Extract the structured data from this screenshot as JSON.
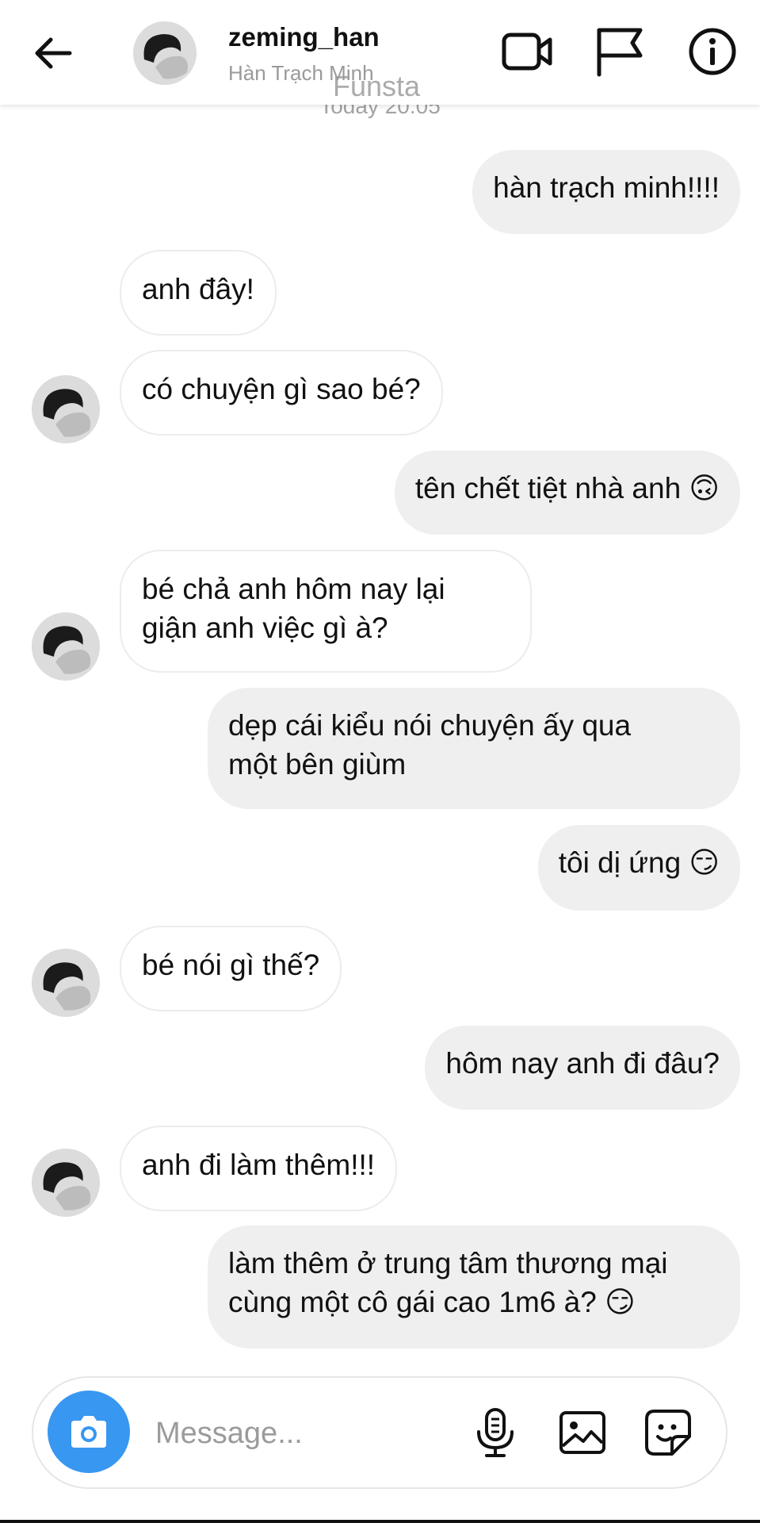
{
  "header": {
    "username": "zeming_han",
    "display_name": "Hàn Trạch Minh",
    "watermark": "Funsta"
  },
  "timestamp": "Today 20:05",
  "messages": [
    {
      "side": "sent",
      "text": "hàn trạch minh!!!!"
    },
    {
      "side": "recv",
      "text": "anh đây!"
    },
    {
      "side": "recv",
      "text": "có chuyện gì sao bé?"
    },
    {
      "side": "sent",
      "text": "tên chết tiệt nhà anh 🙃"
    },
    {
      "side": "recv",
      "text": "bé chả anh hôm nay lại\ngiận anh việc gì à?"
    },
    {
      "side": "sent",
      "text": "dẹp cái kiểu nói chuyện ấy qua\nmột bên giùm"
    },
    {
      "side": "sent",
      "text": "tôi dị ứng 😏"
    },
    {
      "side": "recv",
      "text": "bé nói gì thế?"
    },
    {
      "side": "sent",
      "text": "hôm nay anh đi đâu?"
    },
    {
      "side": "recv",
      "text": "anh đi làm thêm!!!"
    },
    {
      "side": "sent",
      "text": "làm thêm ở trung tâm thương mại\ncùng một cô gái cao 1m6 à? 😏"
    }
  ],
  "composer": {
    "placeholder": "Message..."
  },
  "icons": {
    "back": "arrow-left-icon",
    "video": "video-camera-icon",
    "flag": "flag-icon",
    "info": "info-circle-icon",
    "camera": "camera-icon",
    "mic": "microphone-icon",
    "gallery": "image-icon",
    "sticker": "sticker-icon"
  },
  "colors": {
    "accent": "#3897f0",
    "sent_bubble": "#efefef",
    "recv_border": "#ececec"
  }
}
